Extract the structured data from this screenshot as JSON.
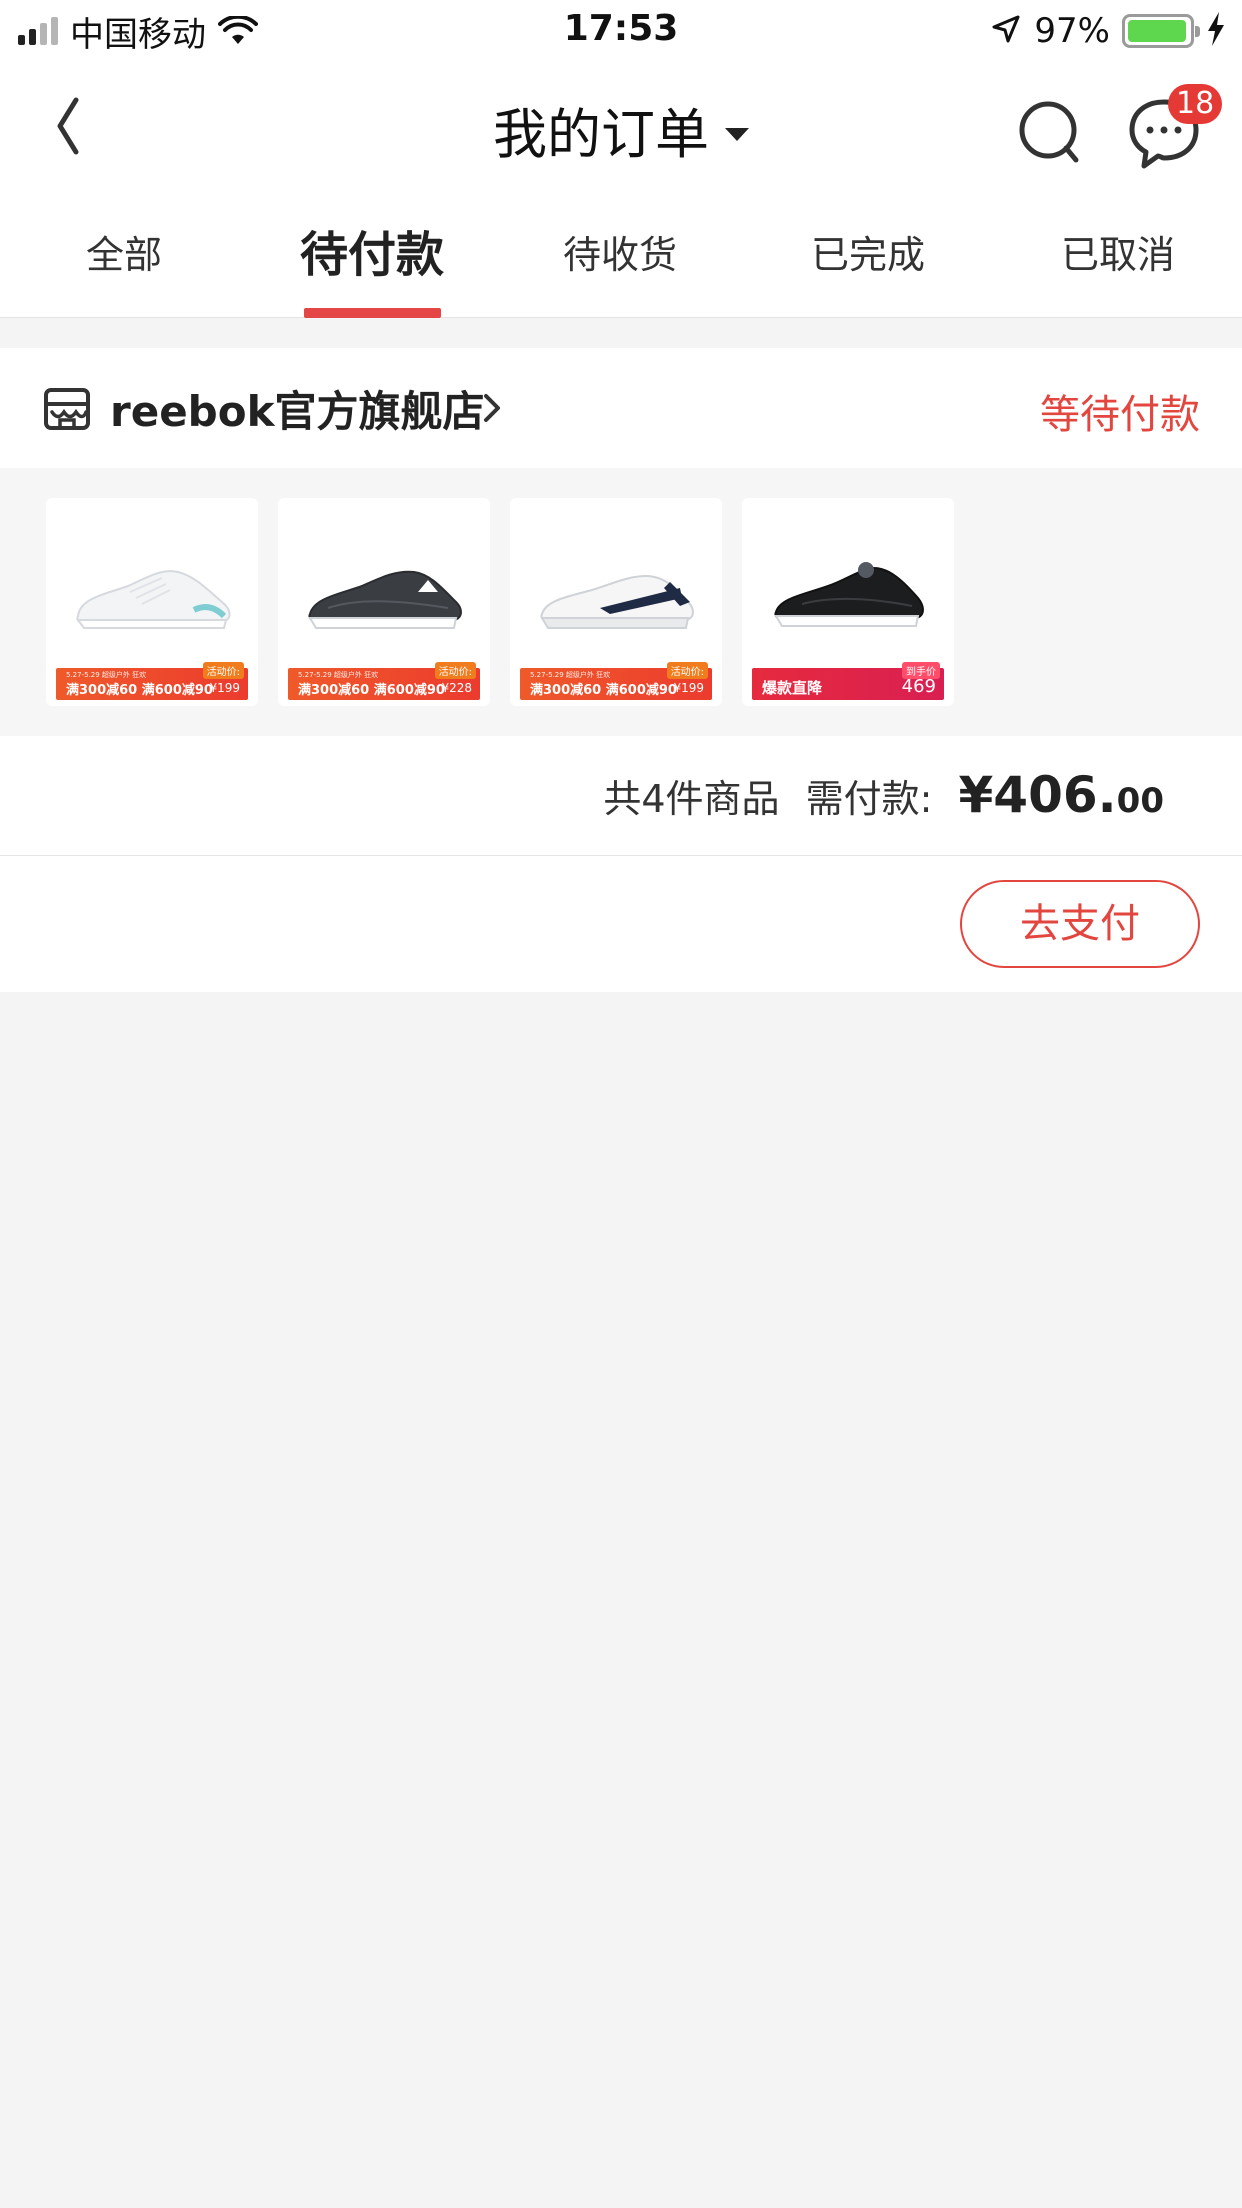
{
  "status_bar": {
    "carrier": "中国移动",
    "time": "17:53",
    "battery_percent": "97%",
    "battery_level": 0.97,
    "signal_bars": 2
  },
  "nav": {
    "title": "我的订单",
    "message_badge": "18"
  },
  "tabs": [
    {
      "label": "全部",
      "active": false
    },
    {
      "label": "待付款",
      "active": true
    },
    {
      "label": "待收货",
      "active": false
    },
    {
      "label": "已完成",
      "active": false
    },
    {
      "label": "已取消",
      "active": false
    }
  ],
  "order": {
    "store_name": "reebok官方旗舰店",
    "status": "等待付款",
    "products": [
      {
        "color": "white-teal",
        "promo": "满300减60 满600减90",
        "promo_small": "5.27-5.29 超级户外 狂欢",
        "tag": "活动价:",
        "price": "¥199"
      },
      {
        "color": "dark-grey",
        "promo": "满300减60 满600减90",
        "promo_small": "5.27-5.29 超级户外 狂欢",
        "tag": "活动价:",
        "price": "¥228"
      },
      {
        "color": "white-navy",
        "promo": "满300减60 满600减90",
        "promo_small": "5.27-5.29 超级户外 狂欢",
        "tag": "活动价:",
        "price": "¥199"
      },
      {
        "color": "black",
        "promo": "爆款直降",
        "promo_small": "",
        "tag": "到手价",
        "price": "469"
      }
    ],
    "summary_count": "共4件商品",
    "summary_label": "需付款:",
    "amount_main": "¥406.",
    "amount_cents": "00",
    "pay_button": "去支付"
  },
  "colors": {
    "accent": "#e2463f",
    "badge": "#e53935",
    "background": "#f4f4f4"
  },
  "icons": {
    "back": "chevron-left-icon",
    "search": "search-icon",
    "message": "chat-bubble-icon",
    "store": "store-icon"
  }
}
